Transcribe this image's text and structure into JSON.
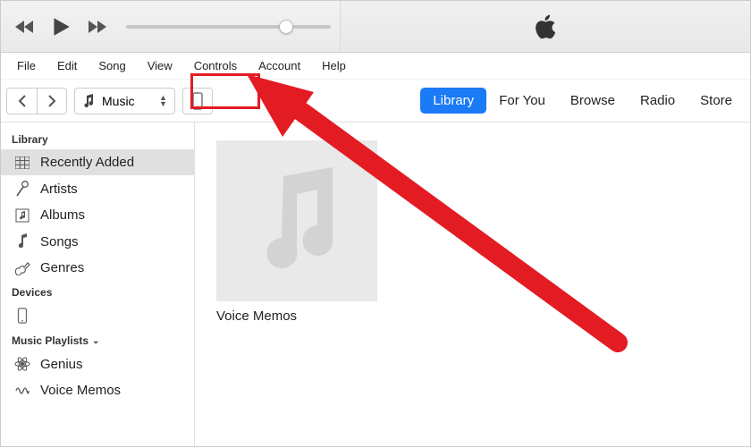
{
  "menubar": [
    "File",
    "Edit",
    "Song",
    "View",
    "Controls",
    "Account",
    "Help"
  ],
  "toolbar": {
    "source_label": "Music"
  },
  "tabs": {
    "items": [
      "Library",
      "For You",
      "Browse",
      "Radio",
      "Store"
    ],
    "active": "Library"
  },
  "sidebar": {
    "groups": [
      {
        "title": "Library",
        "items": [
          {
            "icon": "grid-icon",
            "label": "Recently Added",
            "selected": true
          },
          {
            "icon": "mic-icon",
            "label": "Artists"
          },
          {
            "icon": "album-icon",
            "label": "Albums"
          },
          {
            "icon": "note-icon",
            "label": "Songs"
          },
          {
            "icon": "guitar-icon",
            "label": "Genres"
          }
        ]
      },
      {
        "title": "Devices",
        "items": [
          {
            "icon": "phone-icon",
            "label": ""
          }
        ]
      },
      {
        "title": "Music Playlists",
        "collapsible": true,
        "items": [
          {
            "icon": "genius-icon",
            "label": "Genius"
          },
          {
            "icon": "voice-icon",
            "label": "Voice Memos"
          }
        ]
      }
    ]
  },
  "content": {
    "tiles": [
      {
        "title": "Voice Memos"
      }
    ]
  },
  "annotation": {
    "highlight_color": "#e31b23"
  }
}
